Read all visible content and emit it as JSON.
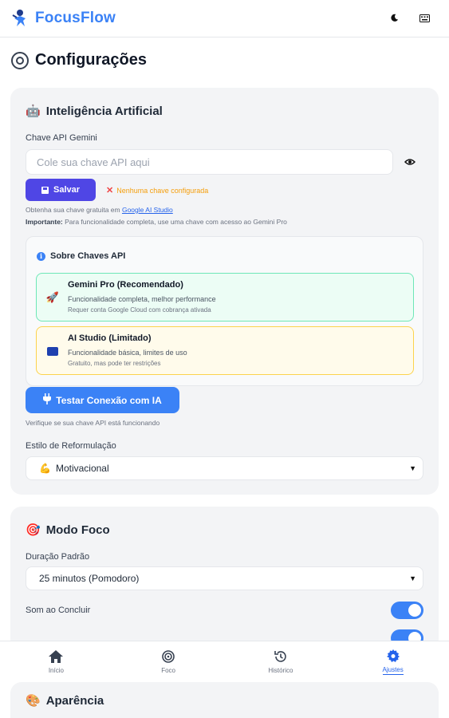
{
  "app": {
    "title": "FocusFlow"
  },
  "header": {
    "theme_icon": "moon-icon",
    "menu_icon": "keyboard-icon"
  },
  "page": {
    "title": "Configurações"
  },
  "ai_section": {
    "title": "Inteligência Artificial",
    "api_key_label": "Chave API Gemini",
    "api_key_placeholder": "Cole sua chave API aqui",
    "api_key_value": "",
    "save_label": "Salvar",
    "status_text": "Nenhuma chave configurada",
    "hint_prefix": "Obtenha sua chave gratuita em ",
    "hint_link": "Google AI Studio",
    "important_label": "Importante:",
    "important_text": " Para funcionalidade completa, use uma chave com acesso ao Gemini Pro",
    "about": {
      "title": "Sobre Chaves API",
      "options": [
        {
          "name": "Gemini Pro (Recomendado)",
          "desc": "Funcionalidade completa, melhor performance",
          "note": "Requer conta Google Cloud com cobrança ativada"
        },
        {
          "name": "AI Studio (Limitado)",
          "desc": "Funcionalidade básica, limites de uso",
          "note": "Gratuito, mas pode ter restrições"
        }
      ]
    },
    "test_label": "Testar Conexão com IA",
    "test_hint": "Verifique se sua chave API está funcionando",
    "style_label": "Estilo de Reformulação",
    "style_value": "Motivacional"
  },
  "focus_section": {
    "title": "Modo Foco",
    "duration_label": "Duração Padrão",
    "duration_value": "25 minutos (Pomodoro)",
    "sound_label": "Som ao Concluir",
    "sound_enabled": true,
    "second_toggle_enabled": true
  },
  "appearance_section": {
    "title": "Aparência"
  },
  "bottom_nav": [
    {
      "label": "Início",
      "icon": "home-icon",
      "active": false
    },
    {
      "label": "Foco",
      "icon": "target-icon",
      "active": false
    },
    {
      "label": "Histórico",
      "icon": "history-icon",
      "active": false
    },
    {
      "label": "Ajustes",
      "icon": "gear-icon",
      "active": true
    }
  ],
  "colors": {
    "primary": "#3b82f6",
    "save_button": "#4f46e5",
    "warning": "#f59e0b",
    "card_bg": "#f3f4f6"
  }
}
